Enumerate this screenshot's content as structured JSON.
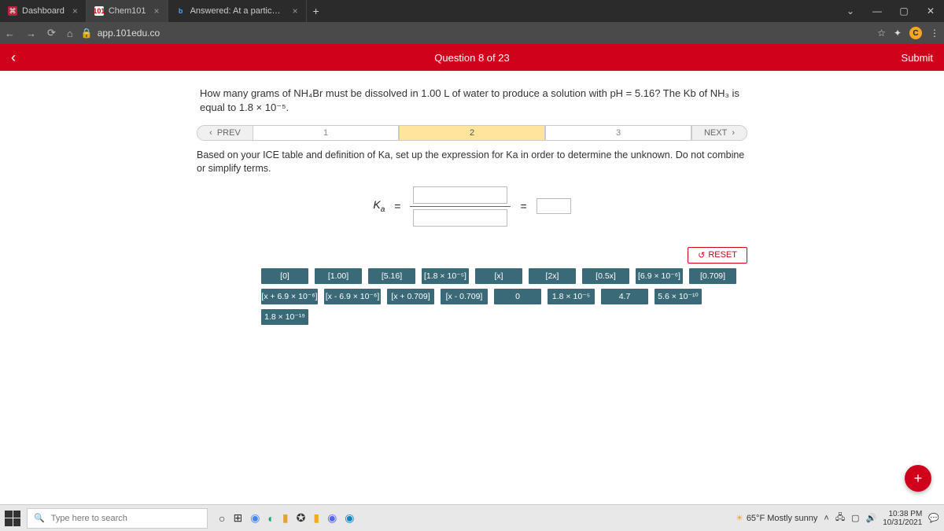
{
  "browser": {
    "tabs": [
      {
        "label": "Dashboard"
      },
      {
        "label": "Chem101"
      },
      {
        "label": "Answered: At a particular tempe"
      }
    ],
    "url": "app.101edu.co"
  },
  "appbar": {
    "question_counter": "Question 8 of 23",
    "submit_label": "Submit"
  },
  "question": {
    "text": "How many grams of NH₄Br must be dissolved in 1.00 L of water to produce a solution with pH = 5.16? The Kb of NH₃ is equal to 1.8 × 10⁻⁵."
  },
  "stepper": {
    "prev": "PREV",
    "next": "NEXT",
    "steps": [
      "1",
      "2",
      "3"
    ],
    "current": 1
  },
  "instructions": "Based on your ICE table and definition of Ka, set up the expression for Ka in order to determine the unknown. Do not combine or simplify terms.",
  "equation": {
    "lhs": "Ka",
    "eq": "="
  },
  "reset_label": "RESET",
  "tiles": [
    "[0]",
    "[1.00]",
    "[5.16]",
    "[1.8 × 10⁻⁵]",
    "[x]",
    "[2x]",
    "[0.5x]",
    "[6.9 × 10⁻⁶]",
    "[0.709]",
    "[x + 6.9 × 10⁻⁶]",
    "[x - 6.9 × 10⁻⁶]",
    "[x + 0.709]",
    "[x - 0.709]",
    "0",
    "1.8 × 10⁻⁵",
    "4.7",
    "5.6 × 10⁻¹⁰",
    "1.8 × 10⁻¹⁹"
  ],
  "taskbar": {
    "search_placeholder": "Type here to search",
    "weather": "65°F  Mostly sunny",
    "time": "10:38 PM",
    "date": "10/31/2021"
  }
}
